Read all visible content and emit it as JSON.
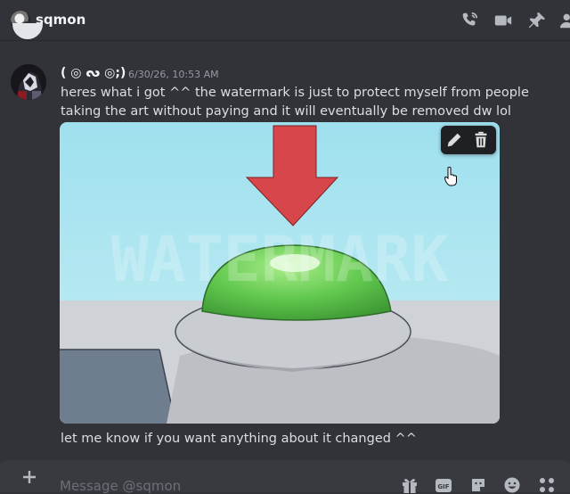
{
  "header": {
    "channel_name": "sqmon",
    "icons": [
      "phone-call-icon",
      "video-call-icon",
      "pin-icon",
      "add-member-icon"
    ]
  },
  "message": {
    "author": "( ◎ ᔓ ◎;)",
    "timestamp": "6/30/26, 10:53 AM",
    "text": "heres what i got ^^ the watermark is just to protect myself from people taking the art without paying and it will eventually be removed dw lol",
    "image_watermark": "WATERMARK",
    "image_tools": [
      "edit-icon",
      "delete-icon"
    ],
    "followup": "let me know if you want anything about it changed ^^"
  },
  "composer": {
    "placeholder": "Message @sqmon",
    "icons": [
      "gift-icon",
      "gif-icon",
      "sticker-icon",
      "emoji-icon",
      "apps-icon"
    ]
  },
  "colors": {
    "background": "#313338",
    "composer": "#383a40",
    "text": "#dbdee1",
    "muted": "#949ba4",
    "button_green": "#5cc54a",
    "arrow_red": "#d6464a"
  }
}
